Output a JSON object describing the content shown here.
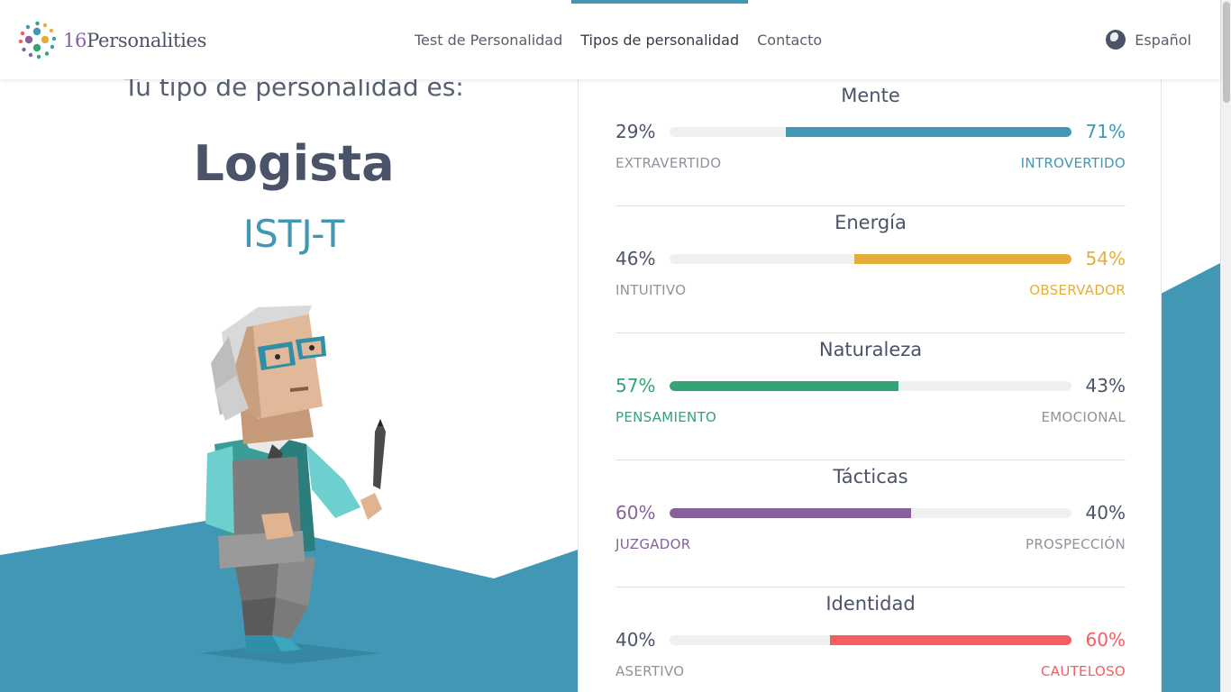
{
  "header": {
    "logo_num": "16",
    "logo_word": "Personalities",
    "nav": [
      {
        "label": "Test de Personalidad",
        "active": false
      },
      {
        "label": "Tipos de personalidad",
        "active": true
      },
      {
        "label": "Contacto",
        "active": false
      }
    ],
    "language": "Español"
  },
  "result": {
    "intro": "Tu tipo de personalidad es:",
    "type_name": "Logista",
    "type_code": "ISTJ-T",
    "illustration": "logistician-character-illustration"
  },
  "colors": {
    "mind": "#4298b4",
    "energy": "#e4ae3a",
    "nature": "#33a474",
    "tactics": "#88619a",
    "identity": "#f25e62",
    "background_shape": "#4298b4"
  },
  "traits": [
    {
      "title": "Mente",
      "left_pct": "29%",
      "right_pct": "71%",
      "left_label": "EXTRAVERTIDO",
      "right_label": "INTROVERTIDO",
      "dominant": "right",
      "value": 71,
      "color_key": "mind"
    },
    {
      "title": "Energía",
      "left_pct": "46%",
      "right_pct": "54%",
      "left_label": "INTUITIVO",
      "right_label": "OBSERVADOR",
      "dominant": "right",
      "value": 54,
      "color_key": "energy"
    },
    {
      "title": "Naturaleza",
      "left_pct": "57%",
      "right_pct": "43%",
      "left_label": "PENSAMIENTO",
      "right_label": "EMOCIONAL",
      "dominant": "left",
      "value": 57,
      "color_key": "nature"
    },
    {
      "title": "Tácticas",
      "left_pct": "60%",
      "right_pct": "40%",
      "left_label": "JUZGADOR",
      "right_label": "PROSPECCIÓN",
      "dominant": "left",
      "value": 60,
      "color_key": "tactics"
    },
    {
      "title": "Identidad",
      "left_pct": "40%",
      "right_pct": "60%",
      "left_label": "ASERTIVO",
      "right_label": "CAUTELOSO",
      "dominant": "right",
      "value": 60,
      "color_key": "identity"
    }
  ]
}
